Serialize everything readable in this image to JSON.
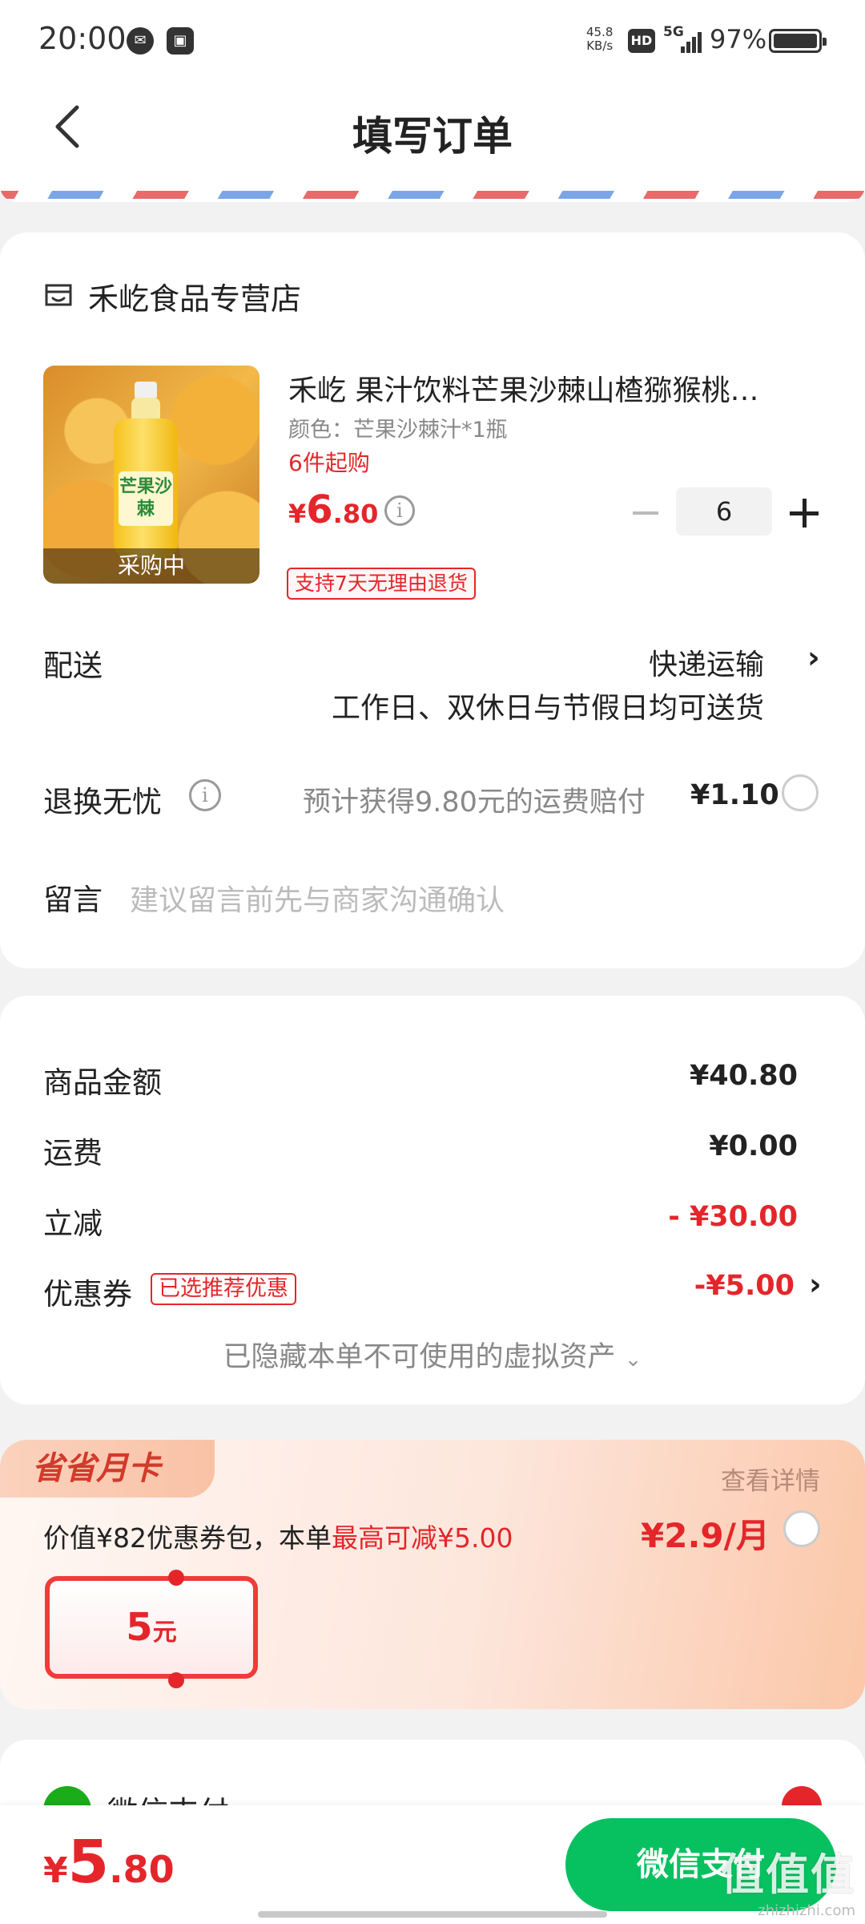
{
  "status_bar": {
    "time": "20:00",
    "net_speed_value": "45.8",
    "net_speed_unit": "KB/s",
    "hd": "HD",
    "network": "5G",
    "battery": "97%"
  },
  "nav": {
    "title": "填写订单"
  },
  "store": {
    "name": "禾屹食品专营店"
  },
  "product": {
    "title": "禾屹 果汁饮料芒果沙棘山楂猕猴桃…",
    "spec": "颜色：芒果沙棘汁*1瓶",
    "min_qty": "6件起购",
    "price_symbol": "¥",
    "price_int": "6",
    "price_dec": ".80",
    "image_label": "芒果沙棘",
    "image_badge": "采购中",
    "quantity": "6",
    "return_tag": "支持7天无理由退货"
  },
  "delivery": {
    "label": "配送",
    "method": "快递运输",
    "note": "工作日、双休日与节假日均可送货"
  },
  "return_insurance": {
    "label": "退换无忧",
    "text": "预计获得9.80元的运费赔付",
    "price": "¥1.10"
  },
  "message": {
    "label": "留言",
    "placeholder": "建议留言前先与商家沟通确认"
  },
  "summary": {
    "goods_label": "商品金额",
    "goods_value": "¥40.80",
    "shipping_label": "运费",
    "shipping_value": "¥0.00",
    "discount_label": "立减",
    "discount_value": "- ¥30.00",
    "coupon_label": "优惠券",
    "coupon_tag": "已选推荐优惠",
    "coupon_value": "-¥5.00",
    "hidden_assets": "已隐藏本单不可使用的虚拟资产"
  },
  "monthly_card": {
    "badge": "省省月卡",
    "detail_link": "查看详情",
    "desc_prefix": "价值¥82优惠券包，本单",
    "desc_highlight": "最高可减¥5.00",
    "price": "¥2.9/月",
    "coupon_amount": "5",
    "coupon_unit": "元"
  },
  "payment": {
    "method": "微信支付"
  },
  "bottom_bar": {
    "total_symbol": "¥",
    "total_int": "5",
    "total_dec": ".80",
    "pay_button": "微信支付"
  },
  "watermark": {
    "main": "值值值",
    "sub": "zhizhizhi.com"
  },
  "colors": {
    "accent_red": "#e4262b",
    "wechat_green": "#07c160"
  }
}
